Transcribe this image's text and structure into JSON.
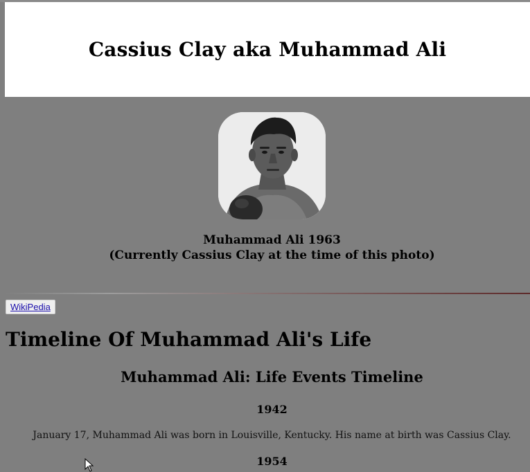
{
  "header": {
    "title": "Cassius Clay aka Muhammad Ali"
  },
  "photo": {
    "caption_line1": "Muhammad Ali 1963",
    "caption_line2": "(Currently Cassius Clay at the time of this photo)"
  },
  "links": {
    "wikipedia_label": "WikiPedia"
  },
  "timeline": {
    "heading": "Timeline Of Muhammad Ali's Life",
    "subheading": "Muhammad Ali: Life Events Timeline",
    "entries": [
      {
        "year": "1942",
        "text": "January 17, Muhammad Ali was born in Louisville, Kentucky. His name at birth was Cassius Clay."
      },
      {
        "year": "1954",
        "text": ""
      }
    ]
  },
  "colors": {
    "page_background": "#7f7f7f",
    "header_background": "#ffffff",
    "link": "#1a0dab"
  }
}
